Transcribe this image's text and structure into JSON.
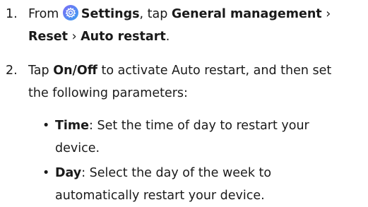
{
  "steps": [
    {
      "number": "1.",
      "line1": {
        "prefix": "From ",
        "icon": "settings-gear-icon",
        "settings": "Settings",
        "mid": ", tap ",
        "general_management": "General management",
        "chevron": " ›"
      },
      "line2": {
        "reset": "Reset",
        "chevron": " › ",
        "auto_restart": "Auto restart",
        "end": "."
      }
    },
    {
      "number": "2.",
      "line1": {
        "prefix": "Tap ",
        "on_off": "On/Off",
        "rest": " to activate Auto restart, and then set"
      },
      "line2": "the following parameters:"
    }
  ],
  "bullets": [
    {
      "term": "Time",
      "line1_rest": ": Set the time of day to restart your",
      "line2": "device."
    },
    {
      "term": "Day",
      "line1_rest": ": Select the day of the week to",
      "line2": "automatically restart your device."
    }
  ],
  "colors": {
    "icon_gradient_start": "#7b6cf6",
    "icon_gradient_end": "#3aa0f0"
  }
}
